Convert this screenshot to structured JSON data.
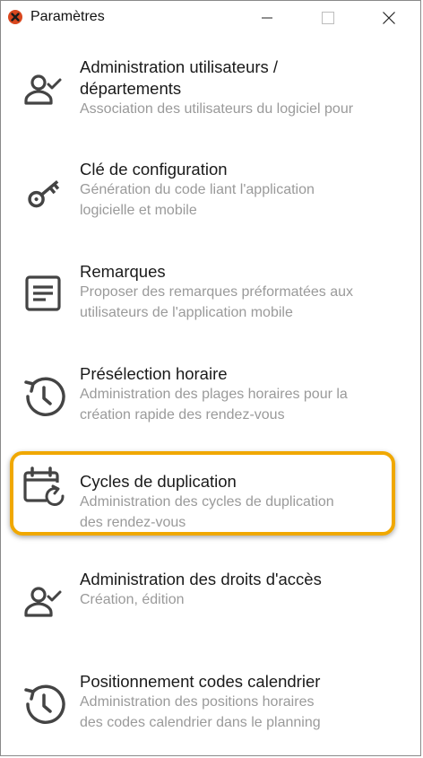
{
  "window": {
    "title": "Paramètres",
    "app_icon": "app-logo-icon",
    "controls": [
      "minimize-icon",
      "maximize-icon",
      "close-icon"
    ]
  },
  "items": [
    {
      "label": "Administration utilisateurs /",
      "label2": "départements",
      "desc": [
        "Association des utilisateurs du logiciel pour"
      ],
      "icon": "user-check-icon"
    },
    {
      "label": "Clé de configuration",
      "desc": [
        "Génération du code liant l'application",
        "logicielle et mobile"
      ],
      "icon": "key-icon"
    },
    {
      "label": "Remarques",
      "desc": [
        "Proposer des remarques préformatées aux",
        "utilisateurs de l'application mobile"
      ],
      "icon": "notes-icon"
    },
    {
      "label": "Présélection horaire",
      "desc": [
        "Administration des plages horaires pour la",
        "création rapide des rendez-vous"
      ],
      "icon": "clock-history-icon"
    },
    {
      "label": "Cycles de duplication",
      "desc": [
        "Administration des cycles de duplication",
        "des rendez-vous"
      ],
      "icon": "calendar-repeat-icon",
      "highlighted": true
    },
    {
      "label": "Administration des droits d'accès",
      "desc": [
        "Création, édition"
      ],
      "icon": "user-check-icon"
    },
    {
      "label": "Positionnement codes calendrier",
      "desc": [
        "Administration des positions horaires",
        "des codes calendrier dans le planning"
      ],
      "icon": "clock-history-icon"
    }
  ],
  "colors": {
    "highlight_border": "#f0a800",
    "icon": "#444444",
    "label": "#1a1a1a",
    "description": "#9a9a9a"
  }
}
